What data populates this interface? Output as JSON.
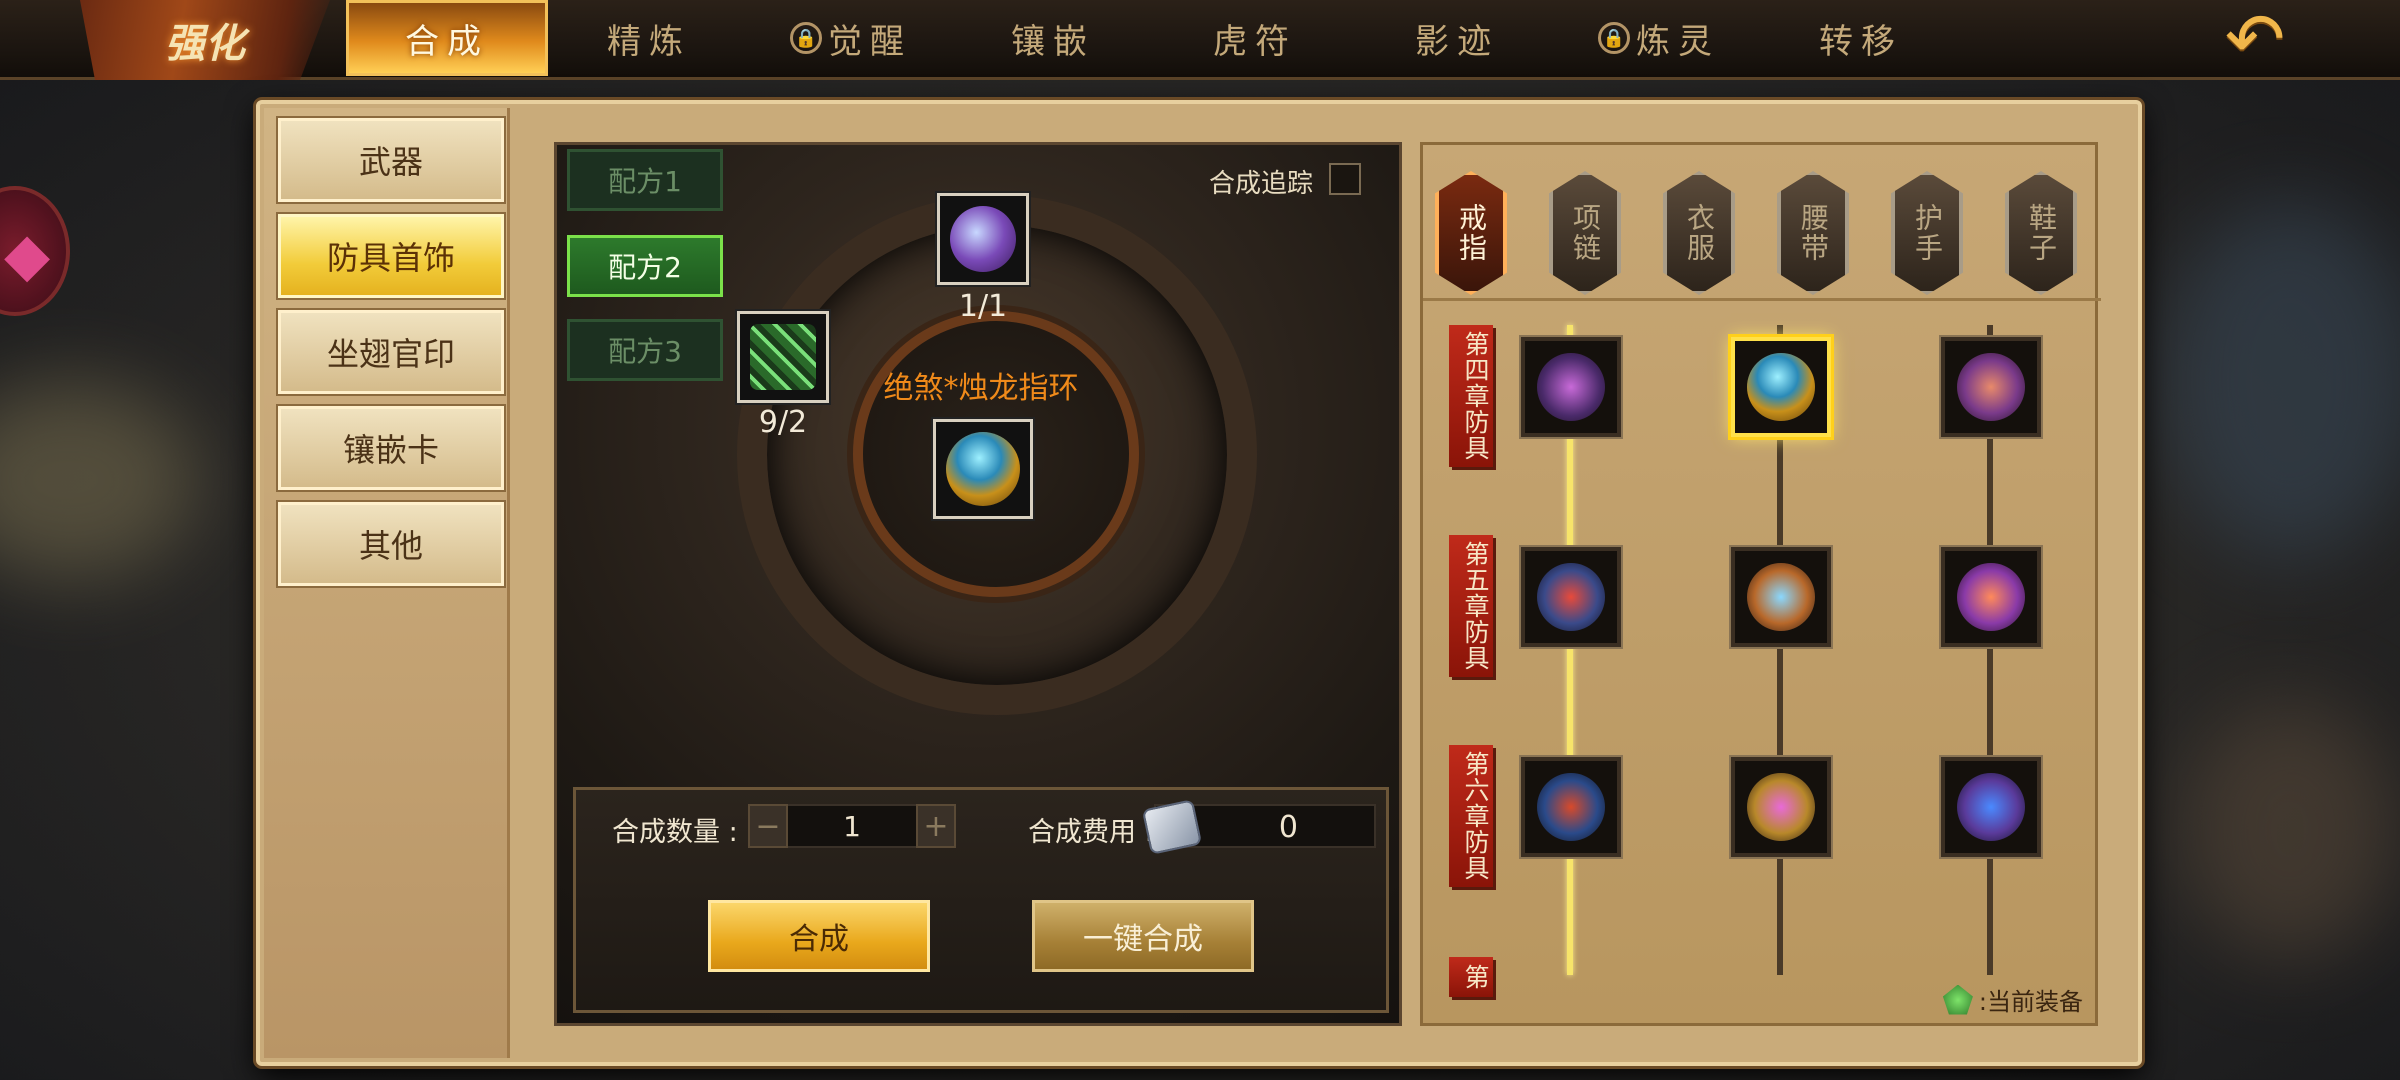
{
  "topbar": {
    "title": "强化",
    "tabs": [
      {
        "label": "合成",
        "active": true,
        "locked": false
      },
      {
        "label": "精炼",
        "active": false,
        "locked": false
      },
      {
        "label": "觉醒",
        "active": false,
        "locked": true
      },
      {
        "label": "镶嵌",
        "active": false,
        "locked": false
      },
      {
        "label": "虎符",
        "active": false,
        "locked": false
      },
      {
        "label": "影迹",
        "active": false,
        "locked": false
      },
      {
        "label": "炼灵",
        "active": false,
        "locked": true
      },
      {
        "label": "转移",
        "active": false,
        "locked": false
      }
    ],
    "back_icon": "back-arrow-icon"
  },
  "categories": [
    "武器",
    "防具首饰",
    "坐翅官印",
    "镶嵌卡",
    "其他"
  ],
  "active_category": "防具首饰",
  "recipes": [
    "配方1",
    "配方2",
    "配方3"
  ],
  "active_recipe": "配方2",
  "track": {
    "label": "合成追踪",
    "checked": false
  },
  "materials": {
    "top_count": "1/1",
    "left_count": "9/2"
  },
  "result_name": "绝煞*烛龙指环",
  "craft": {
    "qty_label": "合成数量 :",
    "qty_value": "1",
    "minus": "−",
    "plus": "+",
    "cost_label": "合成费用 :",
    "cost_value": "0",
    "craft_button": "合成",
    "one_key_button": "一键合成"
  },
  "slot_tabs": [
    "戒指",
    "项链",
    "衣服",
    "腰带",
    "护手",
    "鞋子"
  ],
  "active_slot": "戒指",
  "chapters": [
    "第四章防具",
    "第五章防具",
    "第六章防具",
    "第"
  ],
  "legend": ":当前装备",
  "colors": {
    "accent_gold": "#e9a81c",
    "recipe_green": "#2d7a2c",
    "result_orange": "#f08a1a",
    "chapter_red": "#c02a1a"
  }
}
